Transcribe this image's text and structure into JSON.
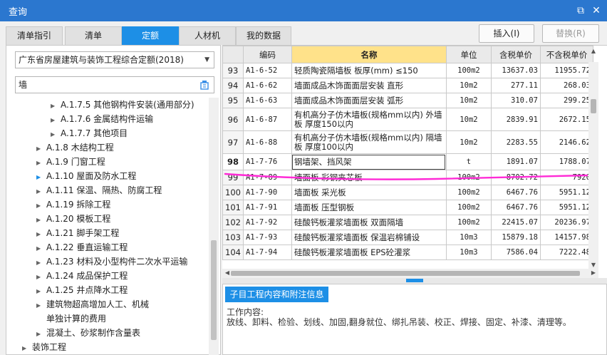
{
  "window": {
    "title": "查询",
    "restore_glyph": "⧉",
    "close_glyph": "✕"
  },
  "tabs": [
    {
      "label": "清单指引",
      "active": false
    },
    {
      "label": "清单",
      "active": false
    },
    {
      "label": "定额",
      "active": true
    },
    {
      "label": "人材机",
      "active": false
    },
    {
      "label": "我的数据",
      "active": false
    }
  ],
  "actions": {
    "insert_label": "插入(I)",
    "replace_label": "替换(R)"
  },
  "left": {
    "library": "广东省房屋建筑与装饰工程综合定额(2018)",
    "search_value": "墙",
    "tree": [
      {
        "label": "A.1.7.5 其他钢构件安装(通用部分)",
        "indent": 3,
        "caret": "▶"
      },
      {
        "label": "A.1.7.6 金属结构件运输",
        "indent": 3,
        "caret": "▶"
      },
      {
        "label": "A.1.7.7 其他项目",
        "indent": 3,
        "caret": "▶"
      },
      {
        "label": "A.1.8 木结构工程",
        "indent": 2,
        "caret": "▶"
      },
      {
        "label": "A.1.9 门窗工程",
        "indent": 2,
        "caret": "▶"
      },
      {
        "label": "A.1.10 屋面及防水工程",
        "indent": 2,
        "caret": "▶",
        "selected": true
      },
      {
        "label": "A.1.11 保温、隔热、防腐工程",
        "indent": 2,
        "caret": "▶"
      },
      {
        "label": "A.1.19 拆除工程",
        "indent": 2,
        "caret": "▶"
      },
      {
        "label": "A.1.20 模板工程",
        "indent": 2,
        "caret": "▶"
      },
      {
        "label": "A.1.21 脚手架工程",
        "indent": 2,
        "caret": "▶"
      },
      {
        "label": "A.1.22 垂直运输工程",
        "indent": 2,
        "caret": "▶"
      },
      {
        "label": "A.1.23 材料及小型构件二次水平运输",
        "indent": 2,
        "caret": "▶"
      },
      {
        "label": "A.1.24 成品保护工程",
        "indent": 2,
        "caret": "▶"
      },
      {
        "label": "A.1.25 井点降水工程",
        "indent": 2,
        "caret": "▶"
      },
      {
        "label": "建筑物超高增加人工、机械",
        "indent": 2,
        "caret": "▶"
      },
      {
        "label": "单独计算的费用",
        "indent": 2,
        "caret": ""
      },
      {
        "label": "混凝土、砂浆制作含量表",
        "indent": 2,
        "caret": "▶"
      },
      {
        "label": "装饰工程",
        "indent": 1,
        "caret": "▶"
      }
    ]
  },
  "grid": {
    "headers": [
      "",
      "编码",
      "名称",
      "单位",
      "含税单价",
      "不含税单价"
    ],
    "rows": [
      {
        "num": "93",
        "code": "A1-6-52",
        "name": "轻质陶瓷隔墙板 板厚(mm) ≤150",
        "unit": "100m2",
        "price": "13637.03",
        "price_ex": "11955.72"
      },
      {
        "num": "94",
        "code": "A1-6-62",
        "name": "墙面成品木饰面面层安装 直形",
        "unit": "10m2",
        "price": "277.11",
        "price_ex": "268.03"
      },
      {
        "num": "95",
        "code": "A1-6-63",
        "name": "墙面成品木饰面面层安装 弧形",
        "unit": "10m2",
        "price": "310.07",
        "price_ex": "299.25"
      },
      {
        "num": "96",
        "code": "A1-6-87",
        "name": "有机高分子仿木墙板(规格mm以内) 外墙板 厚度150以内",
        "unit": "10m2",
        "price": "2839.91",
        "price_ex": "2672.15"
      },
      {
        "num": "97",
        "code": "A1-6-88",
        "name": "有机高分子仿木墙板(规格mm以内) 隔墙板 厚度100以内",
        "unit": "10m2",
        "price": "2283.55",
        "price_ex": "2146.62"
      },
      {
        "num": "98",
        "code": "A1-7-76",
        "name": "钢墙架、挡风架",
        "unit": "t",
        "price": "1891.07",
        "price_ex": "1788.07",
        "selected": true
      },
      {
        "num": "99",
        "code": "A1-7-89",
        "name": "墙面板 彩钢夹芯板",
        "unit": "100m2",
        "price": "8702.72",
        "price_ex": "7920"
      },
      {
        "num": "100",
        "code": "A1-7-90",
        "name": "墙面板 采光板",
        "unit": "100m2",
        "price": "6467.76",
        "price_ex": "5951.12"
      },
      {
        "num": "101",
        "code": "A1-7-91",
        "name": "墙面板 压型钢板",
        "unit": "100m2",
        "price": "6467.76",
        "price_ex": "5951.12"
      },
      {
        "num": "102",
        "code": "A1-7-92",
        "name": "硅酸钙板灌浆墙面板 双面隔墙",
        "unit": "100m2",
        "price": "22415.07",
        "price_ex": "20236.97"
      },
      {
        "num": "103",
        "code": "A1-7-93",
        "name": "硅酸钙板灌浆墙面板 保温岩棉铺设",
        "unit": "10m3",
        "price": "15879.18",
        "price_ex": "14157.98"
      },
      {
        "num": "104",
        "code": "A1-7-94",
        "name": "硅酸钙板灌浆墙面板 EPS砼灌浆",
        "unit": "10m3",
        "price": "7586.04",
        "price_ex": "7222.48"
      }
    ]
  },
  "bottom": {
    "tab_label": "子目工程内容和附注信息",
    "work_title": "工作内容:",
    "work_text": "放线、卸料、检验、划线、加固,翻身就位、绑扎吊装、校正、焊接、固定、补漆、清理等。"
  },
  "colors": {
    "titlebar": "#2b77cf",
    "accent": "#1d8fe6",
    "header_highlight": "#ffe28a",
    "annotation": "#ff2bd6"
  }
}
